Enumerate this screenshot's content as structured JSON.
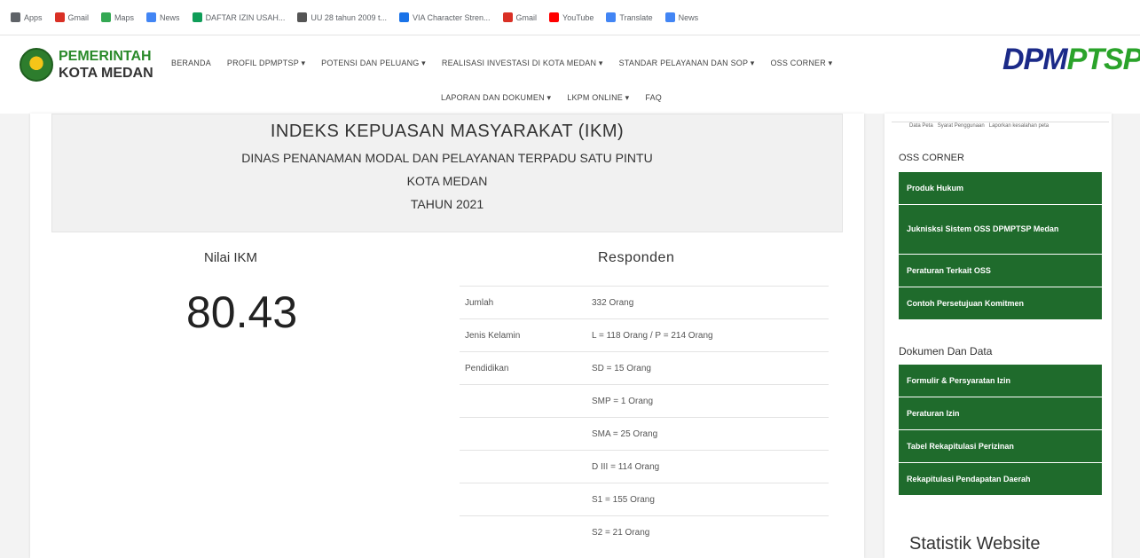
{
  "bookmarks": [
    {
      "label": "Apps",
      "icon": "apps-grid-icon",
      "color": "#5f6368"
    },
    {
      "label": "Gmail",
      "icon": "gmail-icon",
      "color": "#d93025"
    },
    {
      "label": "Maps",
      "icon": "maps-icon",
      "color": "#34a853"
    },
    {
      "label": "News",
      "icon": "news-icon",
      "color": "#4285f4"
    },
    {
      "label": "DAFTAR IZIN USAH...",
      "icon": "sheets-icon",
      "color": "#0f9d58"
    },
    {
      "label": "UU 28 tahun 2009 t...",
      "icon": "globe-icon",
      "color": "#555555"
    },
    {
      "label": "VIA Character Stren...",
      "icon": "via-icon",
      "color": "#1a73e8"
    },
    {
      "label": "Gmail",
      "icon": "gmail-icon",
      "color": "#d93025"
    },
    {
      "label": "YouTube",
      "icon": "youtube-icon",
      "color": "#ff0000"
    },
    {
      "label": "Translate",
      "icon": "translate-icon",
      "color": "#4285f4"
    },
    {
      "label": "News",
      "icon": "news-icon",
      "color": "#4285f4"
    }
  ],
  "logo": {
    "line1": "PEMERINTAH",
    "line2": "KOTA MEDAN"
  },
  "brand": {
    "part1": "DPM",
    "part2": "PTSP"
  },
  "nav": {
    "row1": [
      "BERANDA",
      "PROFIL DPMPTSP ▾",
      "POTENSI DAN PELUANG ▾",
      "REALISASI INVESTASI DI KOTA MEDAN ▾",
      "STANDAR PELAYANAN DAN SOP ▾",
      "OSS CORNER ▾"
    ],
    "row2": [
      "LAPORAN DAN DOKUMEN ▾",
      "LKPM ONLINE ▾",
      "FAQ"
    ]
  },
  "ikm": {
    "title": "INDEKS KEPUASAN MASYARAKAT (IKM)",
    "subtitle": "DINAS PENANAMAN MODAL DAN PELAYANAN TERPADU SATU PINTU",
    "city": "KOTA MEDAN",
    "year": "TAHUN 2021",
    "nilai_label": "Nilai IKM",
    "nilai_value": "80.43",
    "responden_label": "Responden"
  },
  "responden": [
    {
      "key": "Jumlah",
      "value": "332 Orang"
    },
    {
      "key": "Jenis Kelamin",
      "value": "L = 118 Orang / P = 214 Orang"
    },
    {
      "key": "Pendidikan",
      "value": "SD = 15 Orang"
    },
    {
      "key": "",
      "value": "SMP = 1 Orang"
    },
    {
      "key": "",
      "value": "SMA = 25 Orang"
    },
    {
      "key": "",
      "value": "D III = 114 Orang"
    },
    {
      "key": "",
      "value": "S1 = 155 Orang"
    },
    {
      "key": "",
      "value": "S2 = 21 Orang"
    }
  ],
  "sidebar": {
    "top_links": [
      "Data Peta",
      "Syarat Penggunaan",
      "Laporkan kesalahan peta"
    ],
    "oss_heading": "OSS CORNER",
    "oss_items": [
      "Produk Hukum",
      "Juknisksi Sistem OSS DPMPTSP Medan",
      "Peraturan Terkait OSS",
      "Contoh Persetujuan Komitmen"
    ],
    "dok_heading": "Dokumen Dan Data",
    "dok_items": [
      "Formulir & Persyaratan Izin",
      "Peraturan Izin",
      "Tabel Rekapitulasi Perizinan",
      "Rekapitulasi Pendapatan Daerah"
    ],
    "stat_heading": "Statistik Website"
  },
  "colors": {
    "sidebar_button": "#1f6b2c",
    "brand_blue": "#1b2a88",
    "brand_green": "#2aa32a"
  }
}
